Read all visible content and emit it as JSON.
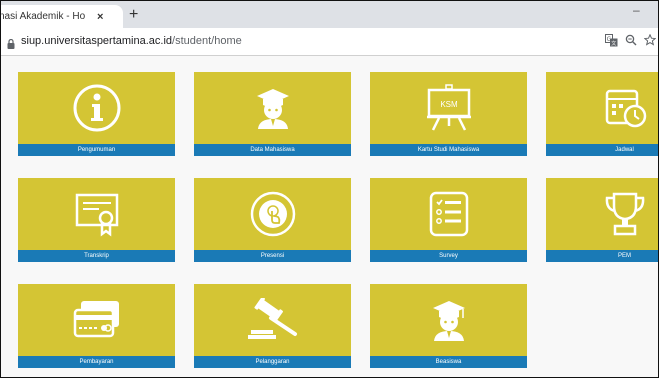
{
  "browser": {
    "tab_title": "nasi Akademik - Ho",
    "tab_close": "×",
    "new_tab": "+",
    "minimize": "–",
    "url_host": "siup.universitaspertamina.ac.id",
    "url_path": "/student/home",
    "icons": [
      "lock-icon",
      "translate-icon",
      "zoom-icon",
      "bookmark-star-icon"
    ]
  },
  "colors": {
    "tile_bg": "#d4c534",
    "label_bg": "#1a7ab6",
    "label_text": "#ffffff"
  },
  "tiles": [
    {
      "label": "Pengumuman",
      "icon": "info-icon"
    },
    {
      "label": "Data Mahasiswa",
      "icon": "student-icon"
    },
    {
      "label": "Kartu Studi Mahasiswa",
      "icon": "ksm-board-icon",
      "icon_text": "KSM"
    },
    {
      "label": "Jadwal",
      "icon": "calendar-clock-icon"
    },
    {
      "label": "Transkrip",
      "icon": "certificate-icon"
    },
    {
      "label": "Presensi",
      "icon": "touch-icon"
    },
    {
      "label": "Survey",
      "icon": "checklist-icon"
    },
    {
      "label": "PEM",
      "icon": "trophy-icon"
    },
    {
      "label": "Pembayaran",
      "icon": "payment-card-icon"
    },
    {
      "label": "Pelanggaran",
      "icon": "gavel-icon"
    },
    {
      "label": "Beasiswa",
      "icon": "graduate-icon"
    }
  ]
}
